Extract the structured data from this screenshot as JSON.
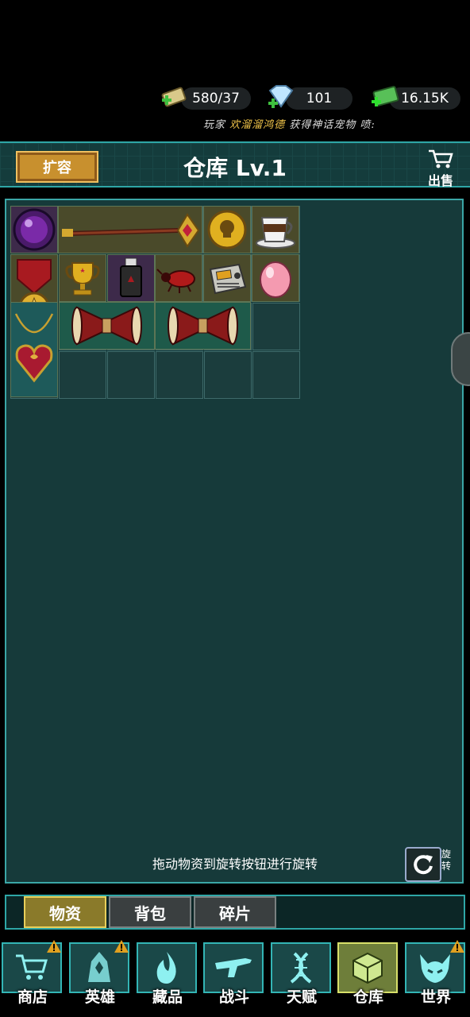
{
  "status_bar": {
    "resources": [
      {
        "icon": "cash-plus-icon",
        "value": "580/37"
      },
      {
        "icon": "diamond-plus-icon",
        "value": "101"
      },
      {
        "icon": "money-stack-plus-icon",
        "value": "16.15K"
      }
    ],
    "marquee": {
      "prefix": "玩家 ",
      "player": "欢溜溜鸿德",
      "suffix": " 获得神话宠物 喷:"
    }
  },
  "header": {
    "expand_label": "扩容",
    "title": "仓库 Lv.1",
    "sell_label": "出售"
  },
  "inventory": {
    "items": [
      "purple-orb",
      "golden-staff",
      "skull-coin",
      "coffee-cup",
      "red-medal",
      "gold-trophy",
      "usb-drive",
      "red-beetle",
      "radio-device",
      "pink-egg",
      "heart-necklace",
      "war-drum",
      "war-drum"
    ]
  },
  "hint": "拖动物资到旋转按钮进行旋转",
  "rotate_label": "旋转",
  "tabs": [
    {
      "label": "物资",
      "active": true
    },
    {
      "label": "背包",
      "active": false
    },
    {
      "label": "碎片",
      "active": false
    }
  ],
  "nav": [
    {
      "label": "商店",
      "icon": "cart-icon",
      "warning": true
    },
    {
      "label": "英雄",
      "icon": "hero-icon",
      "warning": true
    },
    {
      "label": "藏品",
      "icon": "flame-icon",
      "warning": false
    },
    {
      "label": "战斗",
      "icon": "rifle-icon",
      "warning": false
    },
    {
      "label": "天赋",
      "icon": "dna-icon",
      "warning": false
    },
    {
      "label": "仓库",
      "icon": "cube-icon",
      "warning": false,
      "active": true
    },
    {
      "label": "世界",
      "icon": "demon-icon",
      "warning": true
    }
  ],
  "colors": {
    "accent": "#2ea6a6",
    "panel": "#163a3a",
    "gold": "#e8cf5a"
  }
}
